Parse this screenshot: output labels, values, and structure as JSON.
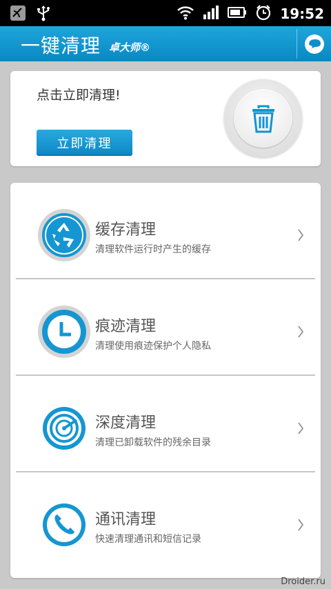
{
  "status_bar": {
    "time": "19:52",
    "icons": [
      "phone-signal-off-icon",
      "usb-icon",
      "wifi-icon",
      "cell-signal-icon",
      "battery-icon",
      "alarm-icon"
    ]
  },
  "app_bar": {
    "title": "一键清理",
    "brand": "卓大师®",
    "action_icon": "chat-bubble-icon"
  },
  "quick_clean": {
    "prompt": "点击立即清理!",
    "button_label": "立即清理",
    "icon": "trash-icon"
  },
  "items": [
    {
      "title": "缓存清理",
      "subtitle": "清理软件运行时产生的缓存",
      "icon": "recycle-icon"
    },
    {
      "title": "痕迹清理",
      "subtitle": "清理使用痕迹保护个人隐私",
      "icon": "clock-icon"
    },
    {
      "title": "深度清理",
      "subtitle": "清理已卸载软件的残余目录",
      "icon": "radar-icon"
    },
    {
      "title": "通讯清理",
      "subtitle": "快速清理通讯和短信记录",
      "icon": "phone-icon"
    }
  ],
  "colors": {
    "accent": "#0f95d3",
    "background": "#c9c9c9"
  },
  "watermark": "Droider.ru"
}
